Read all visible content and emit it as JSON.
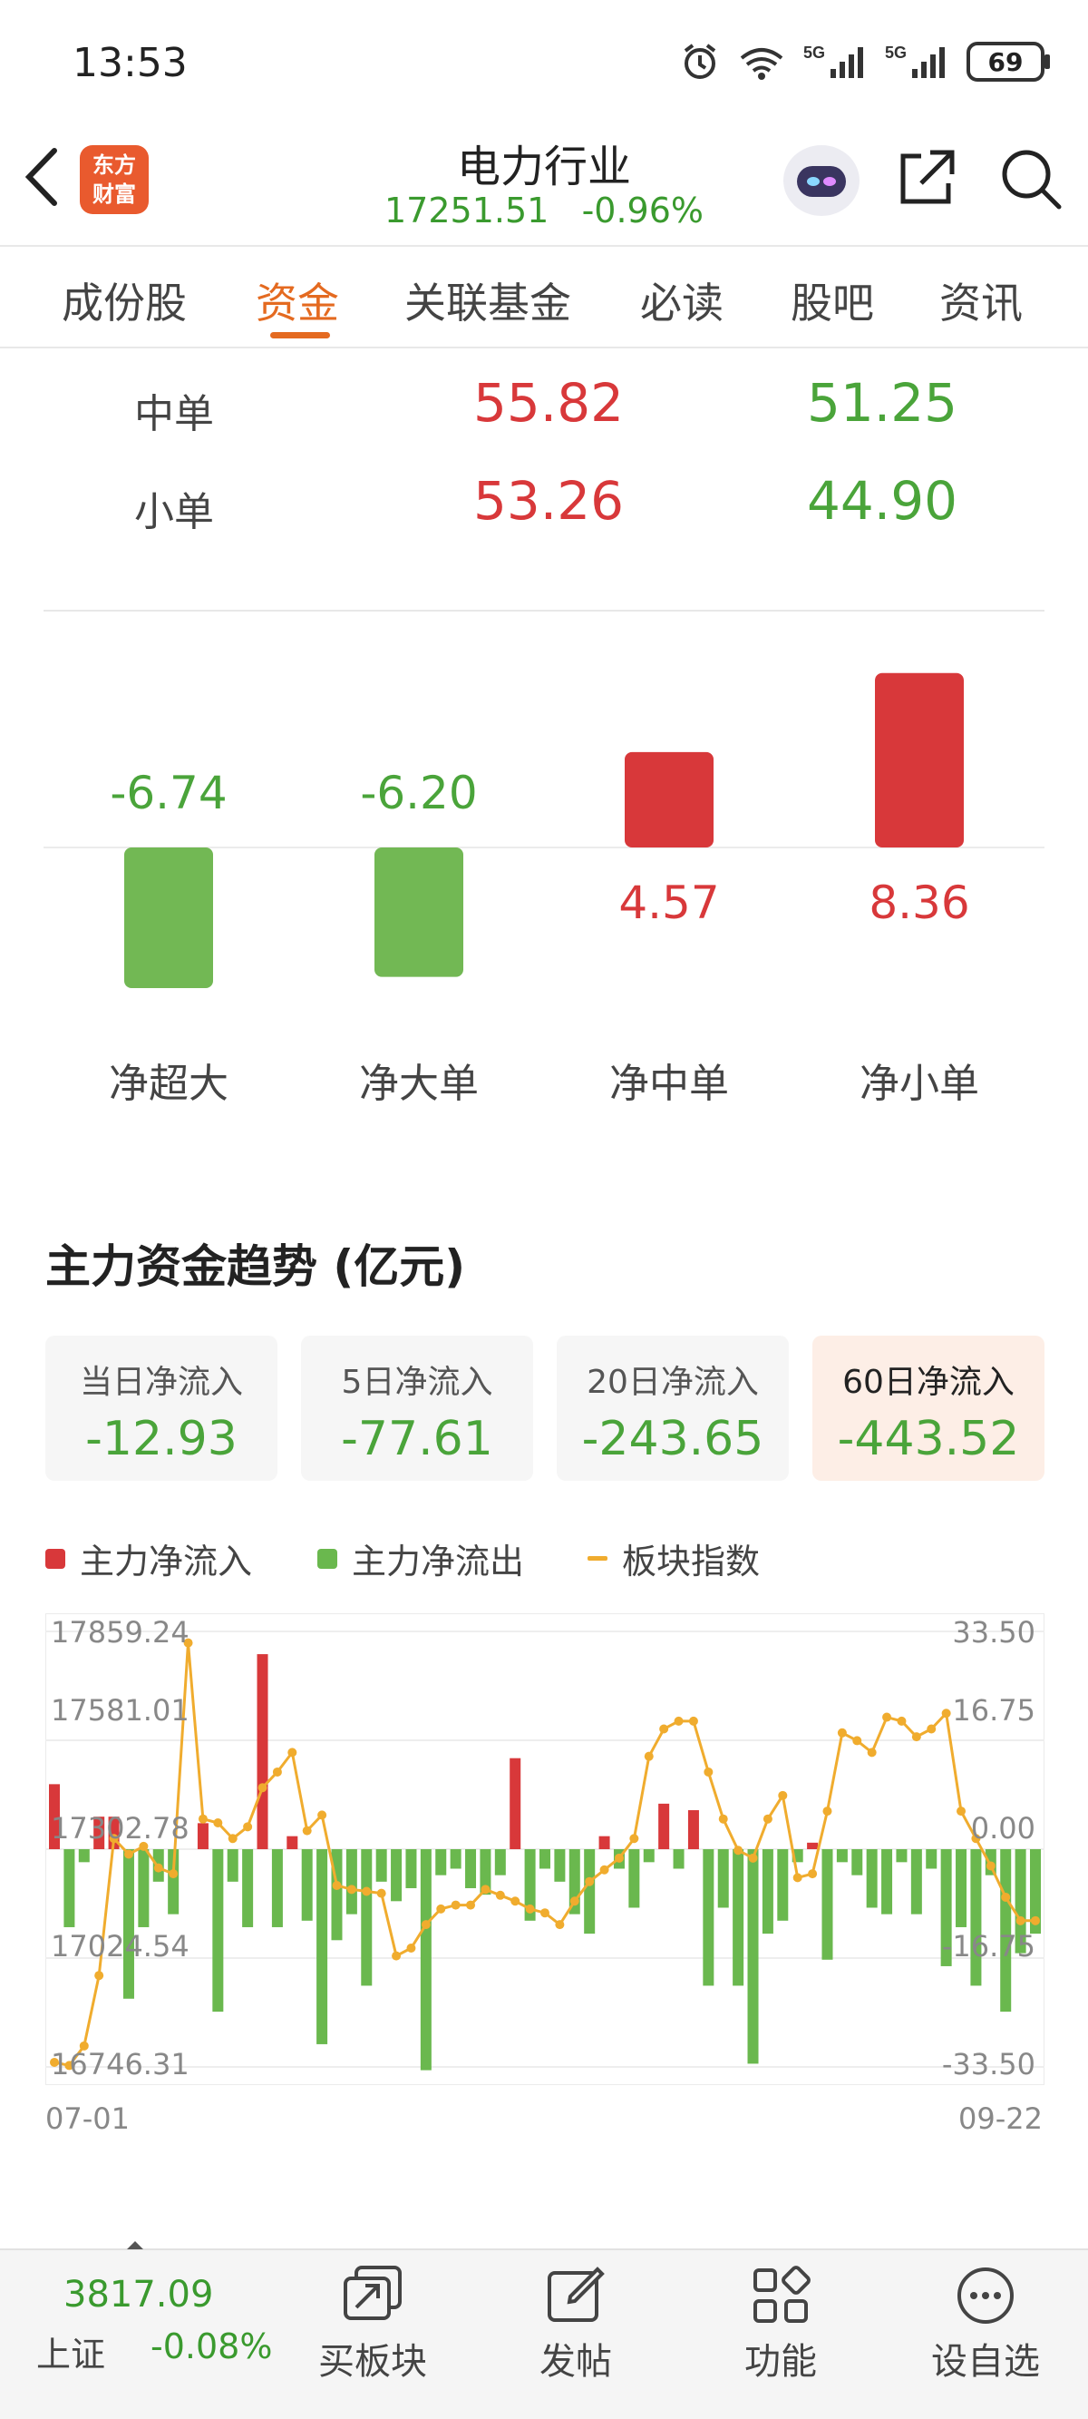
{
  "status_bar": {
    "time": "13:53",
    "battery": "69"
  },
  "header": {
    "logo_line1": "东方",
    "logo_line2": "财富",
    "title": "电力行业",
    "index_value": "17251.51",
    "index_change": "-0.96%"
  },
  "tabs": [
    "成份股",
    "资金",
    "关联基金",
    "必读",
    "股吧",
    "资讯"
  ],
  "active_tab": "资金",
  "orders": [
    {
      "label": "中单",
      "inflow": "55.82",
      "outflow": "51.25"
    },
    {
      "label": "小单",
      "inflow": "53.26",
      "outflow": "44.90"
    }
  ],
  "net_flow_chart": {
    "type": "bar",
    "categories": [
      "净超大",
      "净大单",
      "净中单",
      "净小单"
    ],
    "values": [
      -6.74,
      -6.2,
      4.57,
      8.36
    ],
    "labels": [
      "-6.74",
      "-6.20",
      "4.57",
      "8.36"
    ]
  },
  "section_title": "主力资金趋势 (亿元)",
  "period_cards": [
    {
      "title": "当日净流入",
      "value": "-12.93"
    },
    {
      "title": "5日净流入",
      "value": "-77.61"
    },
    {
      "title": "20日净流入",
      "value": "-243.65"
    },
    {
      "title": "60日净流入",
      "value": "-443.52"
    }
  ],
  "active_period": "60日净流入",
  "legend": {
    "inflow": "主力净流入",
    "outflow": "主力净流出",
    "index": "板块指数"
  },
  "colors": {
    "red": "#d8383a",
    "green": "#6ab84e",
    "orange": "#f0ac2e",
    "accent": "#e46a20"
  },
  "chart_data": {
    "type": "bar+line",
    "x_start": "07-01",
    "x_end": "09-22",
    "left_axis_ticks": [
      "17859.24",
      "17581.01",
      "17302.78",
      "17024.54",
      "16746.31"
    ],
    "right_axis_ticks": [
      "33.50",
      "16.75",
      "0.00",
      "-16.75",
      "-33.50"
    ],
    "left_ylim": [
      16746.31,
      17859.24
    ],
    "right_ylim": [
      -33.5,
      33.5
    ],
    "series": [
      {
        "name": "主力净流入/主力净流出",
        "values": [
          10,
          -12,
          -2,
          5,
          5,
          -23,
          -12,
          -5,
          -10,
          0,
          4,
          -25,
          -5,
          -12,
          30,
          -12,
          2,
          -11,
          -30,
          -14,
          -10,
          -21,
          -5,
          -8,
          -6,
          -34,
          -4,
          -3,
          -6,
          -7,
          -4,
          14,
          -11,
          -3,
          -5,
          -10,
          -13,
          2,
          -3,
          -9,
          -2,
          7,
          -3,
          6,
          -21,
          -9,
          -21,
          -33,
          -13,
          -11,
          -2,
          1,
          -17,
          -2,
          -4,
          -9,
          -10,
          -2,
          -10,
          -3,
          -18,
          -12,
          -21,
          -4,
          -25,
          -16,
          -13
        ],
        "unit": "亿元"
      },
      {
        "name": "板块指数",
        "values": [
          16758,
          16750,
          16800,
          16980,
          17330,
          17290,
          17310,
          17255,
          17240,
          17830,
          17380,
          17370,
          17330,
          17360,
          17460,
          17500,
          17550,
          17350,
          17390,
          17210,
          17200,
          17195,
          17190,
          17030,
          17050,
          17110,
          17150,
          17160,
          17160,
          17200,
          17185,
          17170,
          17150,
          17140,
          17110,
          17170,
          17220,
          17250,
          17280,
          17330,
          17540,
          17610,
          17630,
          17630,
          17500,
          17380,
          17300,
          17280,
          17380,
          17440,
          17230,
          17240,
          17400,
          17600,
          17580,
          17550,
          17640,
          17630,
          17590,
          17610,
          17650,
          17400,
          17330,
          17260,
          17180,
          17120,
          17120
        ]
      }
    ]
  },
  "bottom_bar": {
    "index_value": "3817.09",
    "index_name": "上证",
    "index_change": "-0.08%",
    "items": [
      "买板块",
      "发帖",
      "功能",
      "设自选"
    ]
  }
}
